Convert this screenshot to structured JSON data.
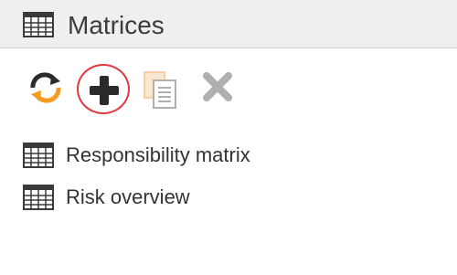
{
  "header": {
    "title": "Matrices",
    "icon": "grid-table-icon"
  },
  "toolbar": {
    "buttons": [
      {
        "name": "refresh",
        "icon": "refresh-icon",
        "state": "enabled"
      },
      {
        "name": "add",
        "icon": "plus-icon",
        "state": "enabled",
        "highlighted": true
      },
      {
        "name": "copy",
        "icon": "copy-icon",
        "state": "disabled"
      },
      {
        "name": "delete",
        "icon": "close-icon",
        "state": "disabled"
      }
    ]
  },
  "list": {
    "items": [
      {
        "label": "Responsibility matrix",
        "icon": "grid-table-icon"
      },
      {
        "label": "Risk overview",
        "icon": "grid-table-icon"
      }
    ]
  },
  "colors": {
    "header_bg": "#efefef",
    "highlight_ring": "#e0393f",
    "icon_dark": "#2b2b2b",
    "refresh_orange": "#f39c1f",
    "disabled_gray": "#b0b0b0",
    "disabled_orange": "#f6cfa3"
  }
}
